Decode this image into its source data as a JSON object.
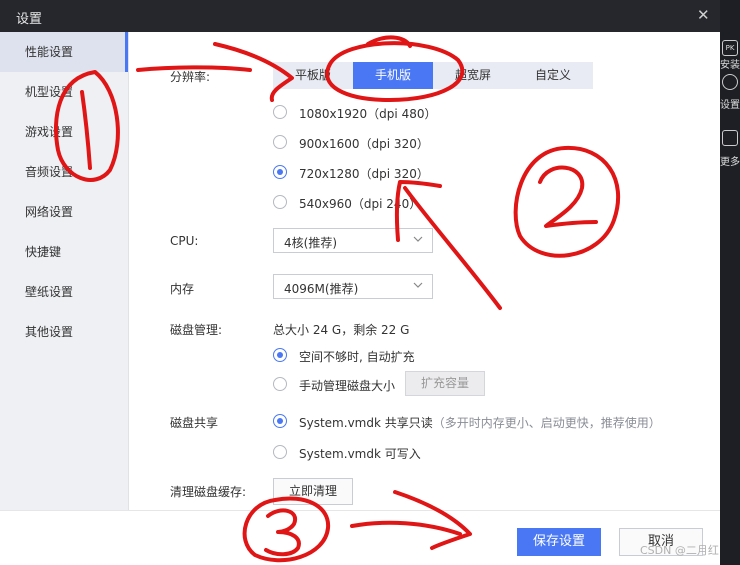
{
  "window": {
    "title": "设置",
    "close_glyph": "✕"
  },
  "sidebar": {
    "items": [
      {
        "label": "性能设置",
        "active": true
      },
      {
        "label": "机型设置"
      },
      {
        "label": "游戏设置"
      },
      {
        "label": "音频设置"
      },
      {
        "label": "网络设置"
      },
      {
        "label": "快捷键"
      },
      {
        "label": "壁纸设置"
      },
      {
        "label": "其他设置"
      }
    ]
  },
  "resolution": {
    "label": "分辨率:",
    "tabs": [
      "平板版",
      "手机版",
      "超宽屏",
      "自定义"
    ],
    "active_tab": "手机版",
    "options": [
      {
        "label": "1080x1920（dpi 480）",
        "checked": false
      },
      {
        "label": "900x1600（dpi 320）",
        "checked": false
      },
      {
        "label": "720x1280（dpi 320）",
        "checked": true
      },
      {
        "label": "540x960（dpi 240）",
        "checked": false
      }
    ]
  },
  "cpu": {
    "label": "CPU:",
    "value": "4核(推荐)"
  },
  "memory": {
    "label": "内存",
    "value": "4096M(推荐)"
  },
  "disk": {
    "label": "磁盘管理:",
    "summary": "总大小 24 G，剩余 22 G",
    "auto_expand": "空间不够时, 自动扩充",
    "manual": "手动管理磁盘大小",
    "expand_button": "扩充容量"
  },
  "disk_share": {
    "label": "磁盘共享",
    "readonly": "System.vmdk 共享只读",
    "readonly_hint": "（多开时内存更小、启动更快，推荐使用）",
    "writable": "System.vmdk 可写入"
  },
  "cache": {
    "label": "清理磁盘缓存:",
    "button": "立即清理"
  },
  "footer": {
    "save": "保存设置",
    "cancel": "取消"
  },
  "right_strip": {
    "apk_icon": "PK",
    "text_install": "安装",
    "text_settings": "设置",
    "text_more": "更多"
  },
  "annotations": {
    "circle_1": "①",
    "circle_2": "②",
    "circle_3": "③",
    "color": "#e01515"
  },
  "watermark": "CSDN @二月红"
}
